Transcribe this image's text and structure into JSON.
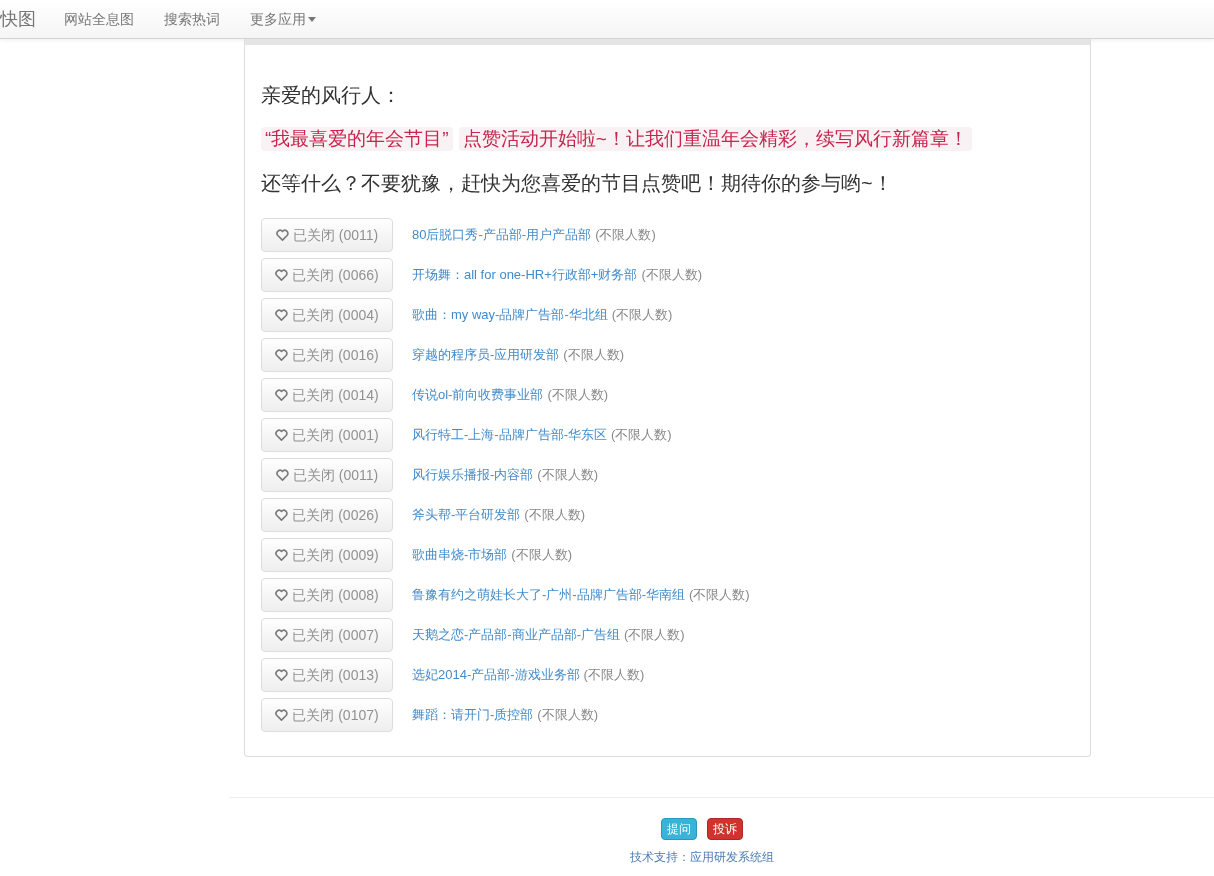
{
  "navbar": {
    "brand": "快图",
    "links": [
      {
        "label": "网站全息图",
        "dropdown": false
      },
      {
        "label": "搜索热词",
        "dropdown": false
      },
      {
        "label": "更多应用",
        "dropdown": true
      }
    ]
  },
  "message": {
    "greeting": "亲爱的风行人：",
    "highlights": [
      "“我最喜爱的年会节目”",
      "点赞活动开始啦~！让我们重温年会精彩，续写风行新篇章！"
    ],
    "call_to_action": "还等什么？不要犹豫，赶快为您喜爱的节目点赞吧！期待你的参与哟~！"
  },
  "programs": [
    {
      "button": "已关闭 (0011)",
      "disabled": true,
      "title": "80后脱口秀-产品部-用户产品部",
      "note": "(不限人数)"
    },
    {
      "button": "已关闭 (0066)",
      "disabled": true,
      "title": "开场舞：all for one-HR+行政部+财务部",
      "note": "(不限人数)"
    },
    {
      "button": "已关闭 (0004)",
      "disabled": true,
      "title": "歌曲：my way-品牌广告部-华北组",
      "note": "(不限人数)"
    },
    {
      "button": "已关闭 (0016)",
      "disabled": true,
      "title": "穿越的程序员-应用研发部",
      "note": "(不限人数)"
    },
    {
      "button": "已关闭 (0014)",
      "disabled": true,
      "title": "传说ol-前向收费事业部",
      "note": "(不限人数)"
    },
    {
      "button": "已关闭 (0001)",
      "disabled": true,
      "title": "风行特工-上海-品牌广告部-华东区",
      "note": "(不限人数)"
    },
    {
      "button": "已关闭 (0011)",
      "disabled": true,
      "title": "风行娱乐播报-内容部",
      "note": "(不限人数)"
    },
    {
      "button": "已关闭 (0026)",
      "disabled": true,
      "title": "斧头帮-平台研发部",
      "note": "(不限人数)"
    },
    {
      "button": "已关闭 (0009)",
      "disabled": true,
      "title": "歌曲串烧-市场部",
      "note": "(不限人数)"
    },
    {
      "button": "已关闭 (0008)",
      "disabled": true,
      "title": "鲁豫有约之萌娃长大了-广州-品牌广告部-华南组",
      "note": "(不限人数)"
    },
    {
      "button": "已关闭 (0007)",
      "disabled": true,
      "title": "天鹅之恋-产品部-商业产品部-广告组",
      "note": "(不限人数)"
    },
    {
      "button": "已关闭 (0013)",
      "disabled": true,
      "title": "选妃2014-产品部-游戏业务部",
      "note": "(不限人数)"
    },
    {
      "button": "已关闭 (0107)",
      "disabled": true,
      "title": "舞蹈：请开门-质控部",
      "note": "(不限人数)"
    }
  ],
  "footer": {
    "buttons": [
      {
        "label": "提问",
        "kind": "info"
      },
      {
        "label": "投诉",
        "kind": "danger"
      }
    ],
    "support": "技术支持：应用研发系统组"
  }
}
